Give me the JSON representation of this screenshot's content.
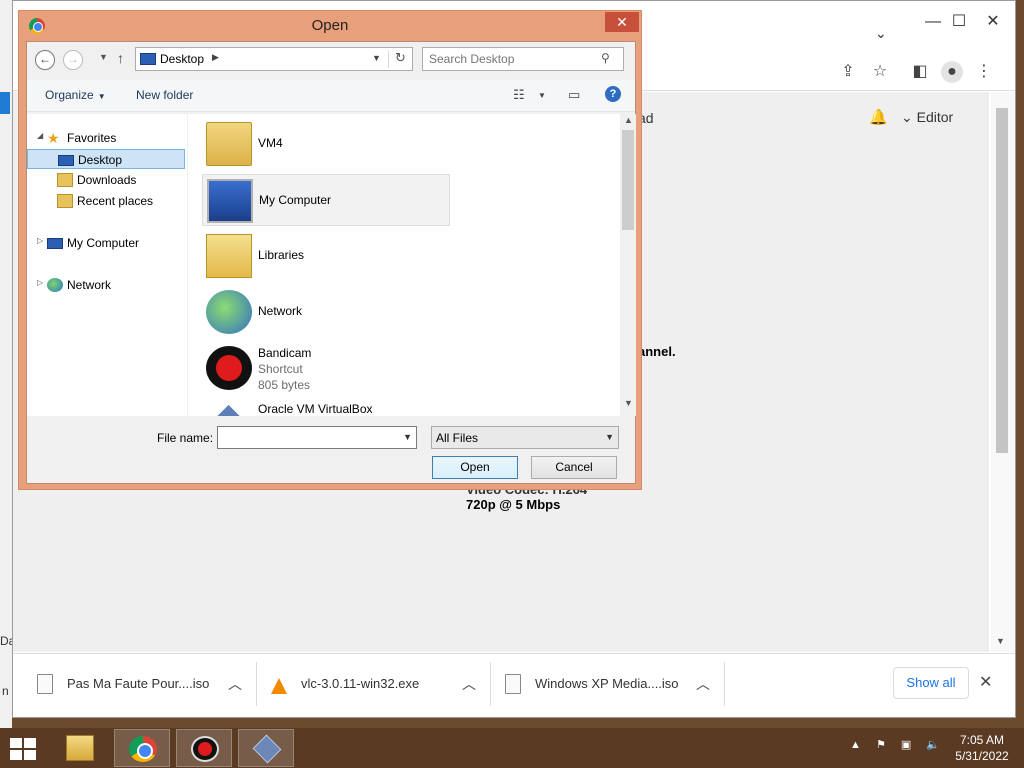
{
  "background": {
    "left_text_1": "Da",
    "left_text_2": "n"
  },
  "browser": {
    "page": {
      "header_text": "ad",
      "editor_label": "Editor",
      "channel_text": "annel.",
      "codec_text": "Video Codec: H.264",
      "bitrate_text": "720p @ 5 Mbps"
    },
    "downloads": [
      {
        "name": "Pas Ma Faute Pour....iso",
        "icon": "iso-file-icon"
      },
      {
        "name": "vlc-3.0.11-win32.exe",
        "icon": "vlc-icon"
      },
      {
        "name": "Windows XP Media....iso",
        "icon": "iso-file-icon"
      }
    ],
    "show_all_label": "Show all"
  },
  "dialog": {
    "title": "Open",
    "address": {
      "location": "Desktop",
      "search_placeholder": "Search Desktop"
    },
    "commands": {
      "organize": "Organize",
      "new_folder": "New folder"
    },
    "nav": {
      "favorites": "Favorites",
      "desktop": "Desktop",
      "downloads": "Downloads",
      "recent": "Recent places",
      "my_computer": "My Computer",
      "network": "Network"
    },
    "files": [
      {
        "name": "VM4"
      },
      {
        "name": "My Computer"
      },
      {
        "name": "Libraries"
      },
      {
        "name": "Network"
      },
      {
        "name": "Bandicam",
        "type": "Shortcut",
        "size": "805 bytes"
      },
      {
        "name": "Oracle VM VirtualBox"
      }
    ],
    "file_name_label": "File name:",
    "file_name_value": "",
    "file_type_filter": "All Files",
    "open_label": "Open",
    "cancel_label": "Cancel"
  },
  "taskbar": {
    "time": "7:05 AM",
    "date": "5/31/2022"
  }
}
